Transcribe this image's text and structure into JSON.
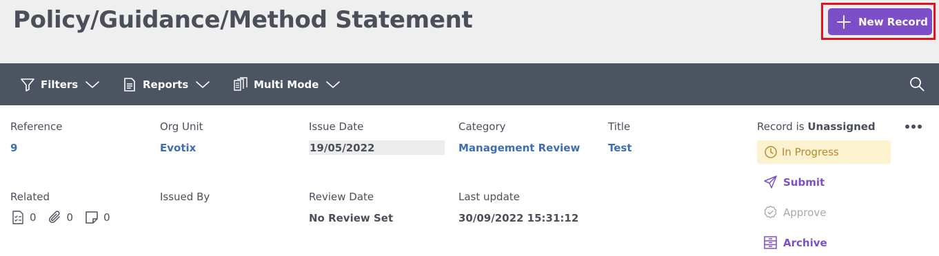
{
  "header": {
    "title": "Policy/Guidance/Method Statement",
    "new_record_label": "New Record"
  },
  "toolbar": {
    "filters_label": "Filters",
    "reports_label": "Reports",
    "multi_mode_label": "Multi Mode"
  },
  "record": {
    "reference": {
      "label": "Reference",
      "value": "9"
    },
    "org_unit": {
      "label": "Org Unit",
      "value": "Evotix"
    },
    "issue_date": {
      "label": "Issue Date",
      "value": "19/05/2022"
    },
    "category": {
      "label": "Category",
      "value": "Management Review"
    },
    "title": {
      "label": "Title",
      "value": "Test"
    },
    "related": {
      "label": "Related",
      "checklists_count": "0",
      "attachments_count": "0",
      "notes_count": "0"
    },
    "issued_by": {
      "label": "Issued By",
      "value": ""
    },
    "review_date": {
      "label": "Review Date",
      "value": "No Review Set"
    },
    "last_update": {
      "label": "Last update",
      "value": "30/09/2022 15:31:12"
    }
  },
  "side_panel": {
    "assignment_prefix": "Record is",
    "assignment_value": "Unassigned",
    "status": "In Progress",
    "actions": {
      "submit": "Submit",
      "approve": "Approve",
      "archive": "Archive"
    }
  },
  "colors": {
    "accent_purple": "#7c4fc8",
    "toolbar_bg": "#4d5461",
    "header_bg": "#efefef",
    "link_blue": "#3f6db3",
    "status_bg": "#fcf2cf",
    "status_text": "#b8892b",
    "highlight_red": "#e0151b"
  },
  "icons": {
    "new_record": "plus-icon",
    "filters": "filter-icon",
    "reports": "document-icon",
    "multi_mode": "multi-files-icon",
    "search": "search-icon",
    "status": "clock-icon",
    "submit": "send-icon",
    "approve": "badge-check-icon",
    "archive": "archive-icon",
    "more": "more-dots-icon"
  }
}
